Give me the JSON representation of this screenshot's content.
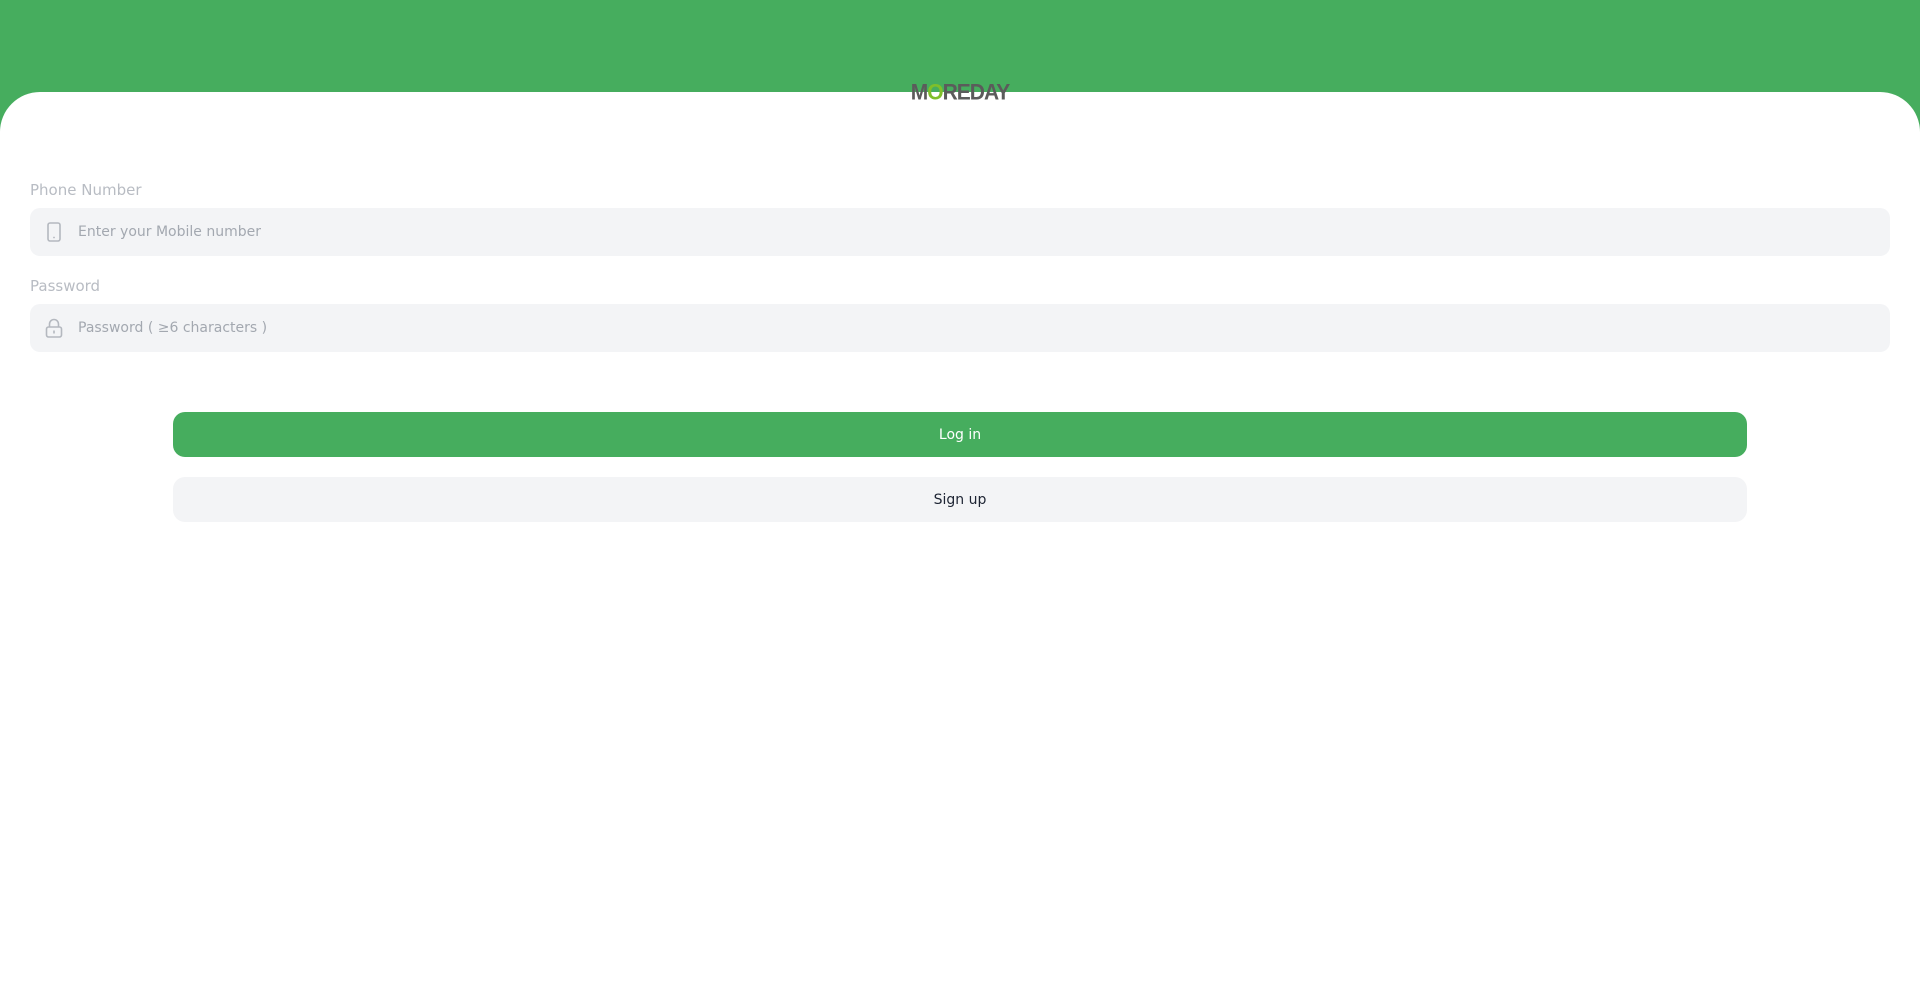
{
  "brand": {
    "logo_text_prefix": "M",
    "logo_text_o": "O",
    "logo_text_suffix": "REDAY",
    "header_color": "#46ad5e",
    "accent_color": "#46ad5e"
  },
  "form": {
    "phone": {
      "label": "Phone Number",
      "placeholder": "Enter your Mobile number",
      "value": "",
      "icon": "phone-icon"
    },
    "password": {
      "label": "Password",
      "placeholder": "Password ( ≥6 characters )",
      "value": "",
      "icon": "lock-icon"
    }
  },
  "actions": {
    "login_label": "Log in",
    "signup_label": "Sign up"
  }
}
